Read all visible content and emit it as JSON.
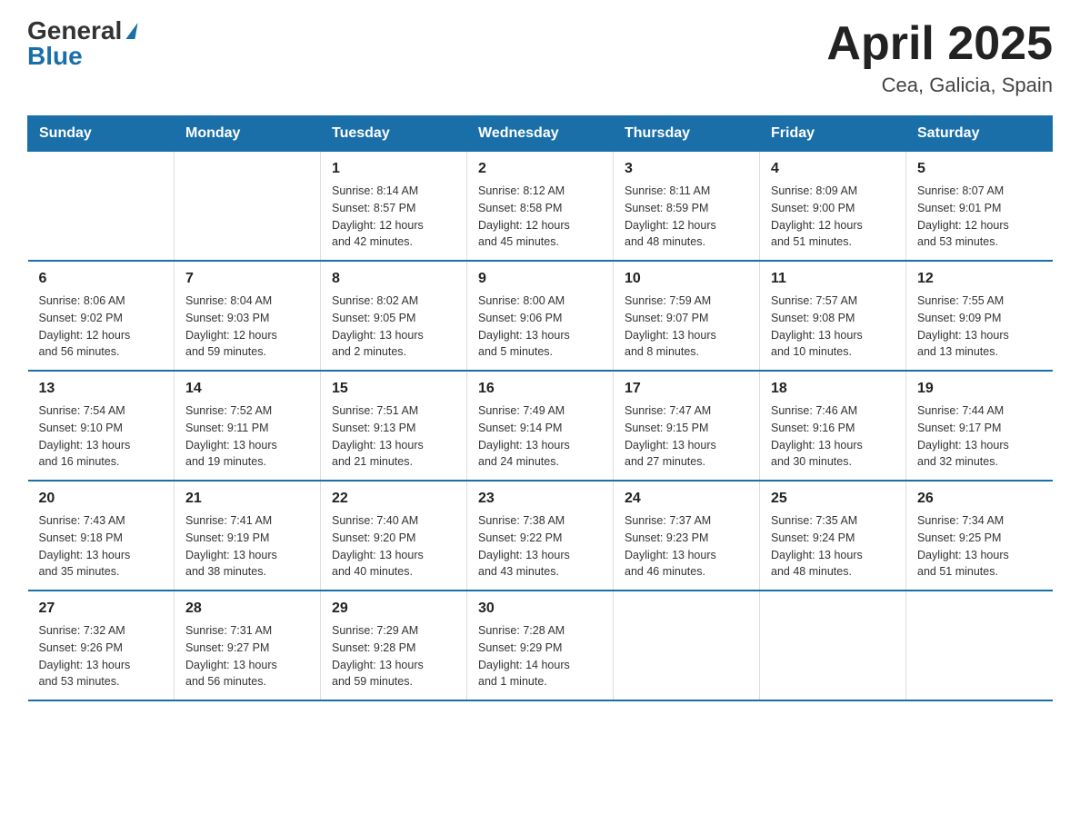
{
  "logo": {
    "general": "General",
    "blue": "Blue"
  },
  "title": "April 2025",
  "subtitle": "Cea, Galicia, Spain",
  "weekdays": [
    "Sunday",
    "Monday",
    "Tuesday",
    "Wednesday",
    "Thursday",
    "Friday",
    "Saturday"
  ],
  "weeks": [
    [
      {
        "day": "",
        "info": ""
      },
      {
        "day": "",
        "info": ""
      },
      {
        "day": "1",
        "info": "Sunrise: 8:14 AM\nSunset: 8:57 PM\nDaylight: 12 hours\nand 42 minutes."
      },
      {
        "day": "2",
        "info": "Sunrise: 8:12 AM\nSunset: 8:58 PM\nDaylight: 12 hours\nand 45 minutes."
      },
      {
        "day": "3",
        "info": "Sunrise: 8:11 AM\nSunset: 8:59 PM\nDaylight: 12 hours\nand 48 minutes."
      },
      {
        "day": "4",
        "info": "Sunrise: 8:09 AM\nSunset: 9:00 PM\nDaylight: 12 hours\nand 51 minutes."
      },
      {
        "day": "5",
        "info": "Sunrise: 8:07 AM\nSunset: 9:01 PM\nDaylight: 12 hours\nand 53 minutes."
      }
    ],
    [
      {
        "day": "6",
        "info": "Sunrise: 8:06 AM\nSunset: 9:02 PM\nDaylight: 12 hours\nand 56 minutes."
      },
      {
        "day": "7",
        "info": "Sunrise: 8:04 AM\nSunset: 9:03 PM\nDaylight: 12 hours\nand 59 minutes."
      },
      {
        "day": "8",
        "info": "Sunrise: 8:02 AM\nSunset: 9:05 PM\nDaylight: 13 hours\nand 2 minutes."
      },
      {
        "day": "9",
        "info": "Sunrise: 8:00 AM\nSunset: 9:06 PM\nDaylight: 13 hours\nand 5 minutes."
      },
      {
        "day": "10",
        "info": "Sunrise: 7:59 AM\nSunset: 9:07 PM\nDaylight: 13 hours\nand 8 minutes."
      },
      {
        "day": "11",
        "info": "Sunrise: 7:57 AM\nSunset: 9:08 PM\nDaylight: 13 hours\nand 10 minutes."
      },
      {
        "day": "12",
        "info": "Sunrise: 7:55 AM\nSunset: 9:09 PM\nDaylight: 13 hours\nand 13 minutes."
      }
    ],
    [
      {
        "day": "13",
        "info": "Sunrise: 7:54 AM\nSunset: 9:10 PM\nDaylight: 13 hours\nand 16 minutes."
      },
      {
        "day": "14",
        "info": "Sunrise: 7:52 AM\nSunset: 9:11 PM\nDaylight: 13 hours\nand 19 minutes."
      },
      {
        "day": "15",
        "info": "Sunrise: 7:51 AM\nSunset: 9:13 PM\nDaylight: 13 hours\nand 21 minutes."
      },
      {
        "day": "16",
        "info": "Sunrise: 7:49 AM\nSunset: 9:14 PM\nDaylight: 13 hours\nand 24 minutes."
      },
      {
        "day": "17",
        "info": "Sunrise: 7:47 AM\nSunset: 9:15 PM\nDaylight: 13 hours\nand 27 minutes."
      },
      {
        "day": "18",
        "info": "Sunrise: 7:46 AM\nSunset: 9:16 PM\nDaylight: 13 hours\nand 30 minutes."
      },
      {
        "day": "19",
        "info": "Sunrise: 7:44 AM\nSunset: 9:17 PM\nDaylight: 13 hours\nand 32 minutes."
      }
    ],
    [
      {
        "day": "20",
        "info": "Sunrise: 7:43 AM\nSunset: 9:18 PM\nDaylight: 13 hours\nand 35 minutes."
      },
      {
        "day": "21",
        "info": "Sunrise: 7:41 AM\nSunset: 9:19 PM\nDaylight: 13 hours\nand 38 minutes."
      },
      {
        "day": "22",
        "info": "Sunrise: 7:40 AM\nSunset: 9:20 PM\nDaylight: 13 hours\nand 40 minutes."
      },
      {
        "day": "23",
        "info": "Sunrise: 7:38 AM\nSunset: 9:22 PM\nDaylight: 13 hours\nand 43 minutes."
      },
      {
        "day": "24",
        "info": "Sunrise: 7:37 AM\nSunset: 9:23 PM\nDaylight: 13 hours\nand 46 minutes."
      },
      {
        "day": "25",
        "info": "Sunrise: 7:35 AM\nSunset: 9:24 PM\nDaylight: 13 hours\nand 48 minutes."
      },
      {
        "day": "26",
        "info": "Sunrise: 7:34 AM\nSunset: 9:25 PM\nDaylight: 13 hours\nand 51 minutes."
      }
    ],
    [
      {
        "day": "27",
        "info": "Sunrise: 7:32 AM\nSunset: 9:26 PM\nDaylight: 13 hours\nand 53 minutes."
      },
      {
        "day": "28",
        "info": "Sunrise: 7:31 AM\nSunset: 9:27 PM\nDaylight: 13 hours\nand 56 minutes."
      },
      {
        "day": "29",
        "info": "Sunrise: 7:29 AM\nSunset: 9:28 PM\nDaylight: 13 hours\nand 59 minutes."
      },
      {
        "day": "30",
        "info": "Sunrise: 7:28 AM\nSunset: 9:29 PM\nDaylight: 14 hours\nand 1 minute."
      },
      {
        "day": "",
        "info": ""
      },
      {
        "day": "",
        "info": ""
      },
      {
        "day": "",
        "info": ""
      }
    ]
  ]
}
